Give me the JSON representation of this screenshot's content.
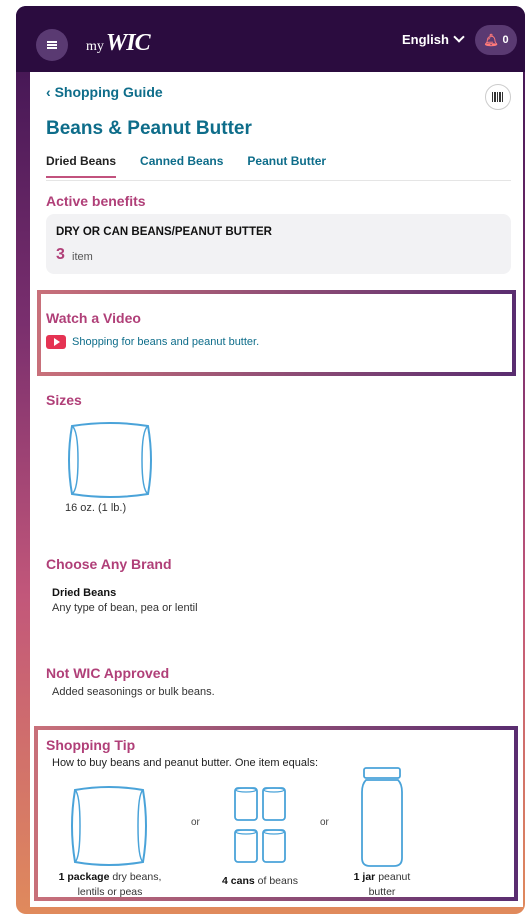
{
  "header": {
    "logo_prefix": "my",
    "logo_main": "WIC",
    "language": "English",
    "notification_count": "0"
  },
  "nav": {
    "back_label": "Shopping Guide"
  },
  "page": {
    "title": "Beans & Peanut Butter",
    "tabs": [
      {
        "label": "Dried Beans",
        "active": true
      },
      {
        "label": "Canned Beans",
        "active": false
      },
      {
        "label": "Peanut Butter",
        "active": false
      }
    ]
  },
  "benefits": {
    "heading": "Active benefits",
    "name": "DRY OR CAN BEANS/PEANUT BUTTER",
    "quantity": "3",
    "unit": "item"
  },
  "video": {
    "heading": "Watch a Video",
    "link_text": "Shopping for beans and peanut butter."
  },
  "sizes": {
    "heading": "Sizes",
    "items": [
      {
        "label": "16 oz. (1 lb.)",
        "icon": "bag-icon"
      }
    ]
  },
  "brand": {
    "heading": "Choose Any Brand",
    "name": "Dried Beans",
    "description": "Any type of bean, pea or lentil"
  },
  "not_approved": {
    "heading": "Not WIC Approved",
    "description": "Added seasonings or bulk beans."
  },
  "tip": {
    "heading": "Shopping Tip",
    "description": "How to buy beans and peanut butter. One item equals:",
    "separator": "or",
    "options": [
      {
        "bold": "1 package",
        "rest_line1": " dry beans,",
        "rest_line2": "lentils or peas",
        "icon": "bag-icon"
      },
      {
        "bold": "4 cans",
        "rest_line1": " of beans",
        "rest_line2": "",
        "icon": "cans-icon"
      },
      {
        "bold": "1 jar",
        "rest_line1": " peanut",
        "rest_line2": "butter",
        "icon": "jar-icon"
      }
    ]
  },
  "colors": {
    "header_bg": "#2b0c3f",
    "link_teal": "#0e6d8a",
    "section_magenta": "#b03f78",
    "icon_blue": "#4aa3d9",
    "youtube_red": "#e53353"
  }
}
